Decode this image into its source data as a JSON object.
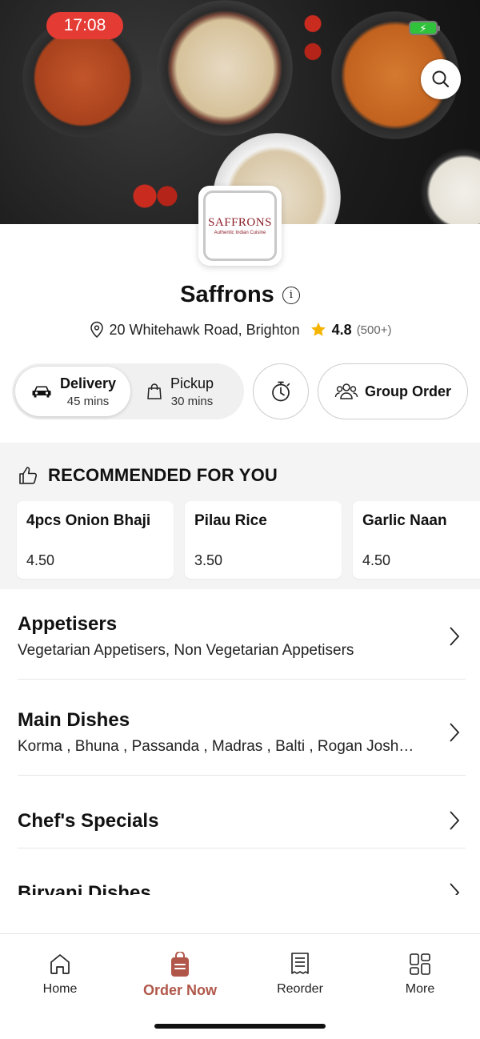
{
  "status_bar": {
    "time": "17:08"
  },
  "restaurant": {
    "logo_name": "SAFFRONS",
    "logo_tagline": "Authentic Indian Cuisine",
    "name": "Saffrons",
    "address": "20 Whitehawk Road, Brighton",
    "rating": "4.8",
    "reviews": "(500+)"
  },
  "order_modes": {
    "delivery": {
      "label": "Delivery",
      "time": "45 mins"
    },
    "pickup": {
      "label": "Pickup",
      "time": "30 mins"
    },
    "group_order_label": "Group Order"
  },
  "recommended": {
    "heading": "RECOMMENDED FOR YOU",
    "items": [
      {
        "name": "4pcs Onion Bhaji",
        "price": "4.50"
      },
      {
        "name": "Pilau Rice",
        "price": "3.50"
      },
      {
        "name": "Garlic Naan",
        "price": "4.50"
      }
    ]
  },
  "categories": [
    {
      "title": "Appetisers",
      "subtitle": "Vegetarian Appetisers, Non Vegetarian Appetisers"
    },
    {
      "title": "Main Dishes",
      "subtitle": "Korma , Bhuna , Passanda , Madras , Balti , Rogan Josh…"
    },
    {
      "title": "Chef's Specials",
      "subtitle": ""
    },
    {
      "title": "Biryani Dishes",
      "subtitle": ""
    }
  ],
  "bottom_nav": [
    {
      "label": "Home",
      "icon": "home-icon"
    },
    {
      "label": "Order Now",
      "icon": "bag-icon"
    },
    {
      "label": "Reorder",
      "icon": "receipt-icon"
    },
    {
      "label": "More",
      "icon": "grid-icon"
    }
  ],
  "colors": {
    "accent": "#b0574a",
    "time_pill": "#e53b35",
    "star": "#f5b400"
  }
}
